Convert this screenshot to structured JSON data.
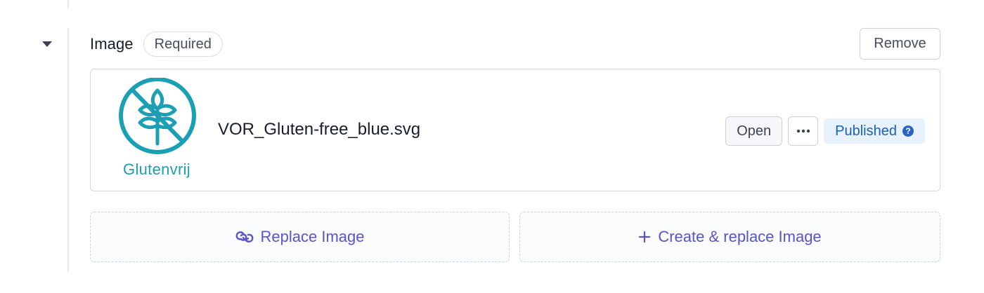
{
  "field": {
    "label": "Image",
    "required_badge": "Required",
    "remove_label": "Remove"
  },
  "asset": {
    "thumbnail_caption": "Glutenvrij",
    "filename": "VOR_Gluten-free_blue.svg",
    "open_label": "Open",
    "more_label": "···",
    "status": "Published",
    "help_icon": "?"
  },
  "actions": {
    "replace_label": "Replace Image",
    "create_replace_label": "Create & replace Image"
  },
  "icons": {
    "collapse": "chevron-down-icon",
    "more": "ellipsis-icon",
    "help": "question-circle-icon",
    "replace": "link-icon",
    "create": "plus-icon"
  },
  "colors": {
    "accent": "#5a54c9",
    "status_bg": "#e7f2fd",
    "status_text": "#1860b8",
    "logo": "#1a9fb5"
  }
}
